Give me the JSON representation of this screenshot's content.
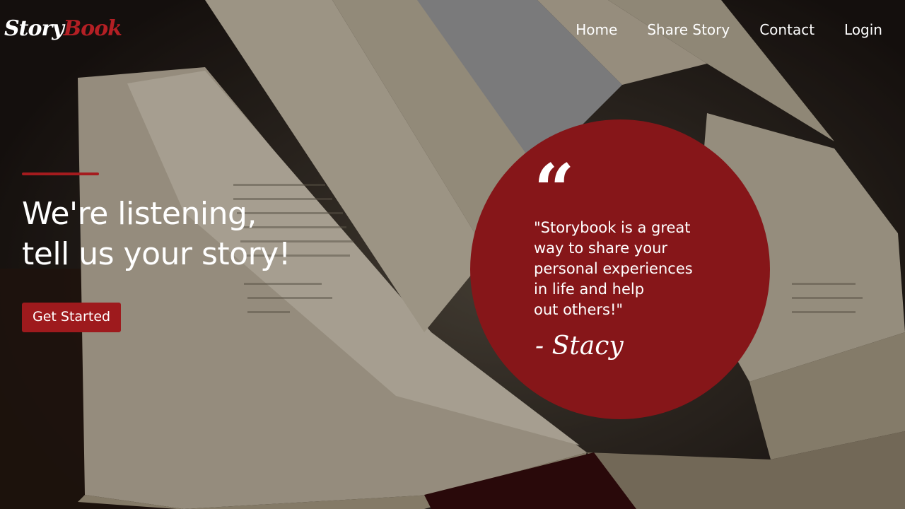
{
  "brand": {
    "part1": "Story",
    "part2": "Book",
    "accent_color": "#b41f24"
  },
  "nav": {
    "items": [
      {
        "label": "Home"
      },
      {
        "label": "Share Story"
      },
      {
        "label": "Contact"
      },
      {
        "label": "Login"
      }
    ]
  },
  "hero": {
    "headline_line1": "We're listening,",
    "headline_line2": "tell us your story!",
    "cta_label": "Get Started",
    "accent_color": "#a51b1e"
  },
  "testimonial": {
    "quote_icon": "quote-icon",
    "lines": [
      "\"Storybook is a great",
      "way to share your",
      "personal experiences",
      "in life and help",
      "out others!\""
    ],
    "author": "- Stacy",
    "circle_color": "#861619"
  }
}
